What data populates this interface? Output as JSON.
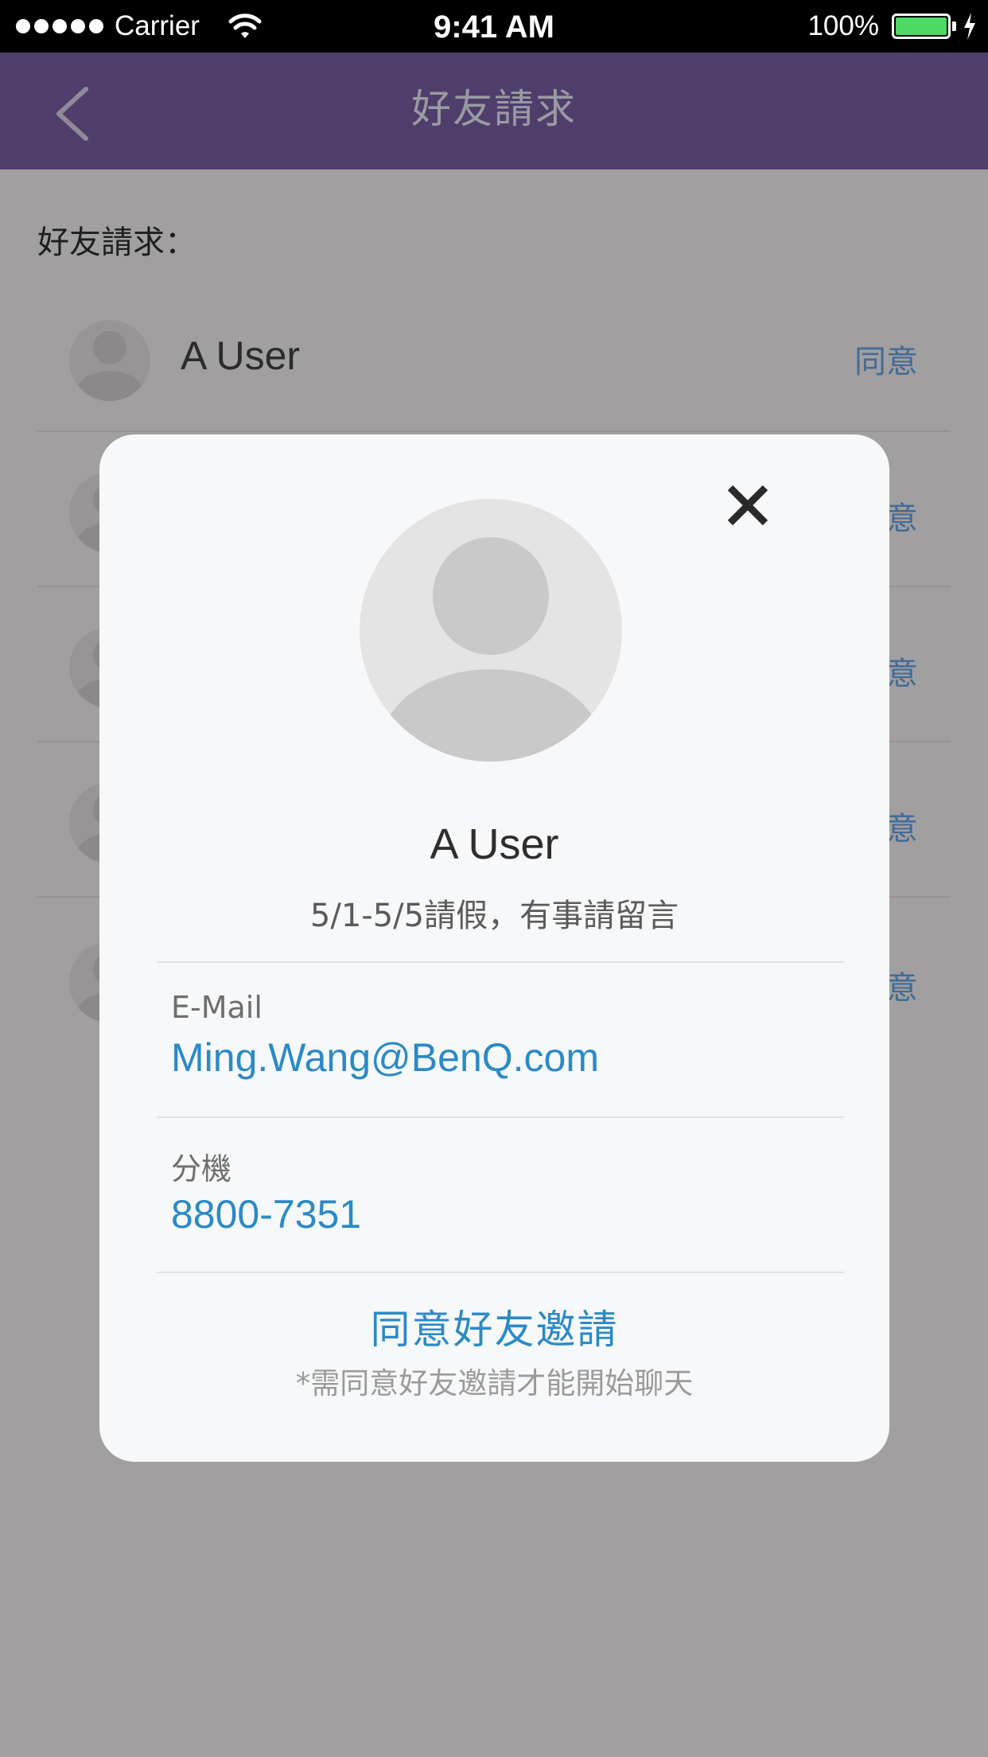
{
  "status_bar": {
    "carrier": "Carrier",
    "time": "9:41 AM",
    "battery": "100%",
    "signal_icon": "signal-dots-icon",
    "wifi_icon": "wifi-icon",
    "battery_icon": "battery-icon",
    "charging_icon": "bolt-icon"
  },
  "nav": {
    "title": "好友請求",
    "back_icon": "chevron-left-icon"
  },
  "page": {
    "section_label": "好友請求：",
    "requests": [
      {
        "name": "A User",
        "agree": "同意"
      },
      {
        "name": "",
        "agree": "意"
      },
      {
        "name": "",
        "agree": "意"
      },
      {
        "name": "",
        "agree": "意"
      },
      {
        "name": "",
        "agree": "意"
      }
    ]
  },
  "modal": {
    "close_icon": "close-icon",
    "avatar_icon": "user-avatar-icon",
    "name": "A User",
    "status_message": "5/1-5/5請假，有事請留言",
    "email_label": "E-Mail",
    "email_value": "Ming.Wang@BenQ.com",
    "extension_label": "分機",
    "extension_value": "8800-7351",
    "accept_button": "同意好友邀請",
    "accept_note": "*需同意好友邀請才能開始聊天"
  },
  "colors": {
    "nav_bg": "#4f3e6c",
    "overlay_bg": "#a29fa0",
    "link": "#2b8ac4",
    "battery": "#4cd964"
  }
}
